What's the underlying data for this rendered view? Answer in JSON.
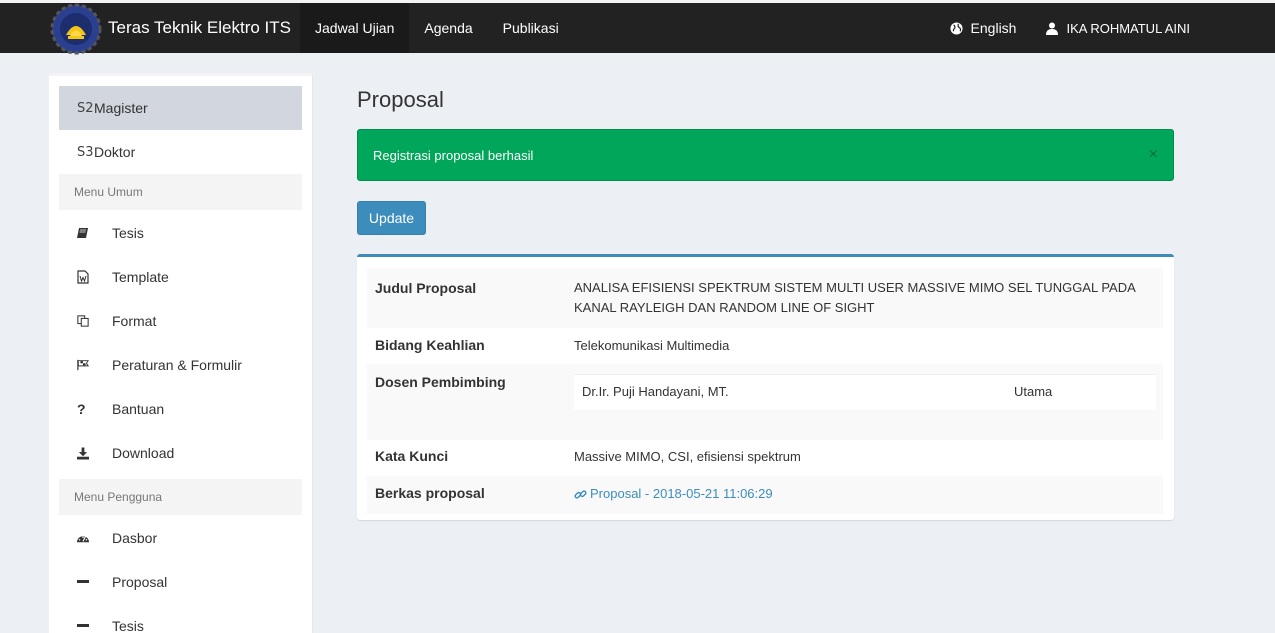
{
  "brand": {
    "title": "Teras Teknik Elektro ITS",
    "logo_icon": "its-logo"
  },
  "topnav": [
    {
      "label": "Jadwal Ujian"
    },
    {
      "label": "Agenda"
    },
    {
      "label": "Publikasi"
    }
  ],
  "topright": {
    "language": "English",
    "user": "IKA ROHMATUL AINI"
  },
  "sidebar": {
    "levels": [
      {
        "code": "S2",
        "label": "Magister"
      },
      {
        "code": "S3",
        "label": "Doktor"
      }
    ],
    "menu_umum_header": "Menu Umum",
    "menu_umum": [
      {
        "label": "Tesis",
        "icon": "book-icon"
      },
      {
        "label": "Template",
        "icon": "word-file-icon"
      },
      {
        "label": "Format",
        "icon": "copy-icon"
      },
      {
        "label": "Peraturan & Formulir",
        "icon": "flag-icon"
      },
      {
        "label": "Bantuan",
        "icon": "question-icon"
      },
      {
        "label": "Download",
        "icon": "download-icon"
      }
    ],
    "menu_pengguna_header": "Menu Pengguna",
    "menu_pengguna": [
      {
        "label": "Dasbor",
        "icon": "dashboard-icon"
      },
      {
        "label": "Proposal",
        "icon": "minus-icon"
      },
      {
        "label": "Tesis",
        "icon": "minus-icon"
      }
    ]
  },
  "page": {
    "title": "Proposal",
    "alert": "Registrasi proposal berhasil",
    "alert_close": "×",
    "update_button": "Update"
  },
  "details": {
    "judul_label": "Judul Proposal",
    "judul_value": "ANALISA EFISIENSI SPEKTRUM SISTEM MULTI USER MASSIVE MIMO SEL TUNGGAL PADA KANAL RAYLEIGH DAN RANDOM LINE OF SIGHT",
    "bidang_label": "Bidang Keahlian",
    "bidang_value": "Telekomunikasi Multimedia",
    "dosen_label": "Dosen Pembimbing",
    "dosen_name": "Dr.Ir. Puji Handayani, MT.",
    "dosen_role": "Utama",
    "kata_label": "Kata Kunci",
    "kata_value": "Massive MIMO, CSI, efisiensi spektrum",
    "berkas_label": "Berkas proposal",
    "berkas_value": "Proposal - 2018-05-21 11:06:29"
  },
  "colors": {
    "topbar": "#222222",
    "alert_success": "#00a65a",
    "primary": "#3c8dbc",
    "sidebar_active": "#d2d6de"
  }
}
